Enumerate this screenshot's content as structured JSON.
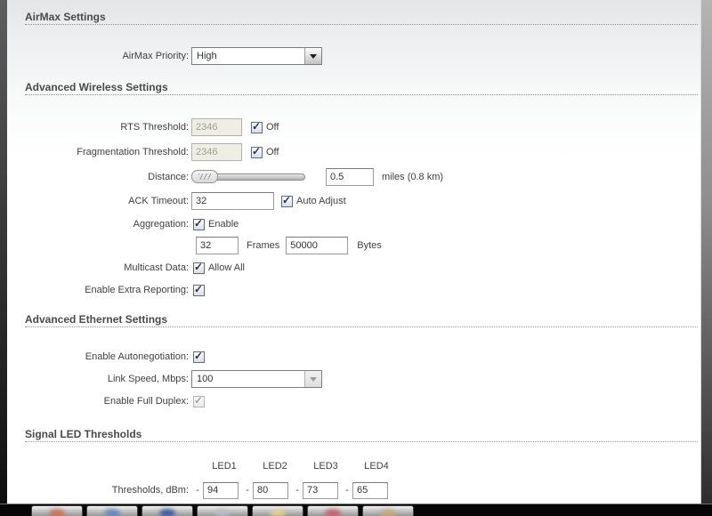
{
  "sections": [
    {
      "title": "AirMax Settings"
    },
    {
      "title": "Advanced Wireless Settings"
    },
    {
      "title": "Advanced Ethernet Settings"
    },
    {
      "title": "Signal LED Thresholds"
    }
  ],
  "airmax": {
    "priority_label": "AirMax Priority:",
    "priority_value": "High"
  },
  "wireless": {
    "rts_label": "RTS Threshold:",
    "rts_value": "2346",
    "rts_off_label": "Off",
    "frag_label": "Fragmentation Threshold:",
    "frag_value": "2346",
    "frag_off_label": "Off",
    "distance_label": "Distance:",
    "distance_value": "0.5",
    "distance_unit": "miles (0.8 km)",
    "ack_label": "ACK Timeout:",
    "ack_value": "32",
    "ack_auto_label": "Auto Adjust",
    "aggregation_label": "Aggregation:",
    "aggregation_enable_label": "Enable",
    "frames_value": "32",
    "frames_label": "Frames",
    "bytes_value": "50000",
    "bytes_label": "Bytes",
    "multicast_label": "Multicast Data:",
    "multicast_allow_label": "Allow All",
    "extra_reporting_label": "Enable Extra Reporting:"
  },
  "ethernet": {
    "autoneg_label": "Enable Autonegotiation:",
    "link_speed_label": "Link Speed, Mbps:",
    "link_speed_value": "100",
    "full_duplex_label": "Enable Full Duplex:"
  },
  "led": {
    "col_headers": [
      "LED1",
      "LED2",
      "LED3",
      "LED4"
    ],
    "row_label": "Thresholds, dBm:",
    "separator": "-",
    "values": [
      "94",
      "80",
      "73",
      "65"
    ]
  },
  "colors": {
    "section_header_text": "#4a4a4a",
    "checkbox_check": "#243252",
    "disabled_field_bg": "#efeee5",
    "taskbar_bg": "#060606"
  },
  "taskbar": {
    "buttons": [
      {
        "tint": "#d06a48"
      },
      {
        "tint": "#5a84c4"
      },
      {
        "tint": "#2f4fa2"
      },
      {
        "tint": "#b9bdc9"
      },
      {
        "tint": "#e8d388"
      },
      {
        "tint": "#cf5562"
      },
      {
        "tint": "#c9a878"
      }
    ]
  }
}
